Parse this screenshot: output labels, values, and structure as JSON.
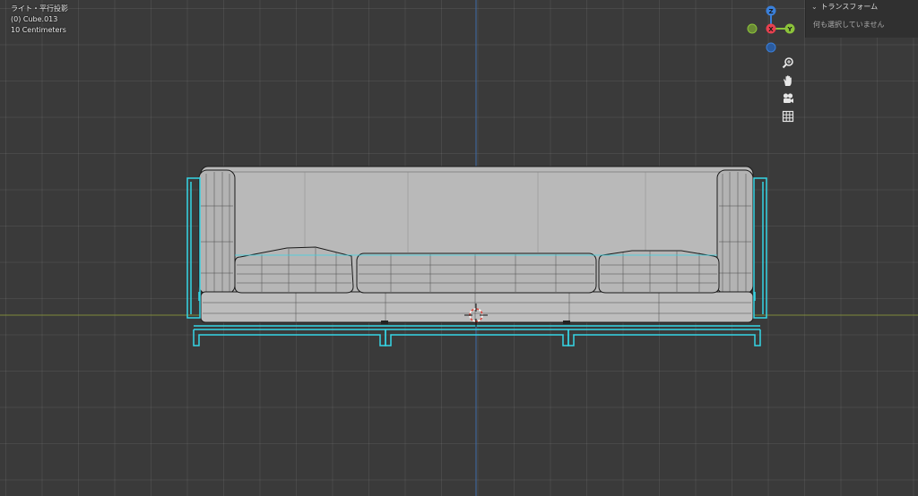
{
  "viewport": {
    "view_name": "ライト・平行投影",
    "object_name": "(0) Cube.013",
    "grid_scale": "10 Centimeters"
  },
  "gizmo": {
    "z_label": "Z",
    "x_label": "X",
    "y_label": "Y",
    "colors": {
      "x": "#e8404f",
      "y": "#8cc33a",
      "z": "#3a7fd9",
      "neg_y": "#6a8a35",
      "neg_x": "#9a3a40"
    }
  },
  "nav_buttons": [
    "zoom-icon",
    "hand-pan-icon",
    "camera-icon",
    "grid-perspective-icon"
  ],
  "sidebar": {
    "panel_title": "トランスフォーム",
    "empty_message": "何も選択していません"
  },
  "colors": {
    "background": "#3a3a3a",
    "selection_outline": "#35d6e6",
    "mesh_fill": "#b8b8b8",
    "x_axis_line": "#7f8b3a",
    "z_axis_line": "#3e6ca8"
  }
}
